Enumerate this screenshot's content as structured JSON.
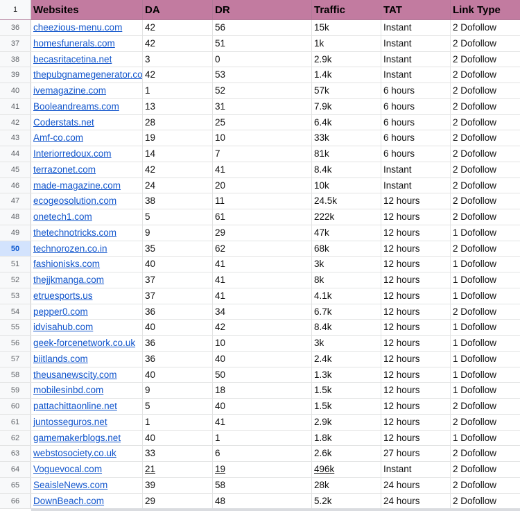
{
  "header": {
    "row_number": "1",
    "columns": [
      "Websites",
      "DA",
      "DR",
      "Traffic",
      "TAT",
      "Link Type"
    ]
  },
  "selected_row": "50",
  "rows": [
    {
      "n": "36",
      "site": "cheezious-menu.com",
      "da": "42",
      "dr": "56",
      "traffic": "15k",
      "tat": "Instant",
      "link": "2 Dofollow"
    },
    {
      "n": "37",
      "site": "homesfunerals.com",
      "da": "42",
      "dr": "51",
      "traffic": "1k",
      "tat": "Instant",
      "link": "2 Dofollow"
    },
    {
      "n": "38",
      "site": "becasritacetina.net",
      "da": "3",
      "dr": "0",
      "traffic": "2.9k",
      "tat": "Instant",
      "link": "2 Dofollow"
    },
    {
      "n": "39",
      "site": "thepubgnamegenerator.co",
      "da": "42",
      "dr": "53",
      "traffic": "1.4k",
      "tat": "Instant",
      "link": "2 Dofollow"
    },
    {
      "n": "40",
      "site": "ivemagazine.com",
      "da": "1",
      "dr": "52",
      "traffic": "57k",
      "tat": "6 hours",
      "link": "2 Dofollow"
    },
    {
      "n": "41",
      "site": "Booleandreams.com",
      "da": "13",
      "dr": "31",
      "traffic": "7.9k",
      "tat": "6 hours",
      "link": "2 Dofollow"
    },
    {
      "n": "42",
      "site": "Coderstats.net",
      "da": "28",
      "dr": "25",
      "traffic": "6.4k",
      "tat": "6 hours",
      "link": "2 Dofollow"
    },
    {
      "n": "43",
      "site": "Amf-co.com",
      "da": "19",
      "dr": "10",
      "traffic": "33k",
      "tat": "6 hours",
      "link": "2 Dofollow"
    },
    {
      "n": "44",
      "site": "Interiorredoux.com",
      "da": "14",
      "dr": "7",
      "traffic": "81k",
      "tat": "6 hours",
      "link": "2 Dofollow"
    },
    {
      "n": "45",
      "site": "terrazonet.com",
      "da": "42",
      "dr": "41",
      "traffic": "8.4k",
      "tat": "Instant",
      "link": "2 Dofollow"
    },
    {
      "n": "46",
      "site": "made-magazine.com",
      "da": "24",
      "dr": "20",
      "traffic": "10k",
      "tat": "Instant",
      "link": "2 Dofollow"
    },
    {
      "n": "47",
      "site": "ecogeosolution.com",
      "da": "38",
      "dr": "11",
      "traffic": "24.5k",
      "tat": "12 hours",
      "link": "2 Dofollow"
    },
    {
      "n": "48",
      "site": "onetech1.com",
      "da": "5",
      "dr": "61",
      "traffic": "222k",
      "tat": "12 hours",
      "link": "2 Dofollow"
    },
    {
      "n": "49",
      "site": "thetechnotricks.com",
      "da": "9",
      "dr": "29",
      "traffic": "47k",
      "tat": "12 hours",
      "link": "1 Dofollow"
    },
    {
      "n": "50",
      "site": "technorozen.co.in",
      "da": "35",
      "dr": "62",
      "traffic": "68k",
      "tat": "12 hours",
      "link": "2 Dofollow"
    },
    {
      "n": "51",
      "site": "fashionisks.com",
      "da": "40",
      "dr": "41",
      "traffic": "3k",
      "tat": "12 hours",
      "link": "1 Dofollow"
    },
    {
      "n": "52",
      "site": "thejjkmanga.com",
      "da": "37",
      "dr": "41",
      "traffic": "8k",
      "tat": "12 hours",
      "link": "1 Dofollow"
    },
    {
      "n": "53",
      "site": "etruesports.us",
      "da": "37",
      "dr": "41",
      "traffic": "4.1k",
      "tat": "12 hours",
      "link": "1 Dofollow"
    },
    {
      "n": "54",
      "site": "pepper0.com",
      "da": "36",
      "dr": "34",
      "traffic": "6.7k",
      "tat": "12 hours",
      "link": "2 Dofollow"
    },
    {
      "n": "55",
      "site": "idvisahub.com",
      "da": "40",
      "dr": "42",
      "traffic": "8.4k",
      "tat": "12 hours",
      "link": "1 Dofollow"
    },
    {
      "n": "56",
      "site": "geek-forcenetwork.co.uk",
      "da": "36",
      "dr": "10",
      "traffic": "3k",
      "tat": "12 hours",
      "link": "1 Dofollow"
    },
    {
      "n": "57",
      "site": "biitlands.com",
      "da": "36",
      "dr": "40",
      "traffic": "2.4k",
      "tat": "12 hours",
      "link": "1 Dofollow"
    },
    {
      "n": "58",
      "site": "theusanewscity.com",
      "da": "40",
      "dr": "50",
      "traffic": "1.3k",
      "tat": "12 hours",
      "link": "1 Dofollow"
    },
    {
      "n": "59",
      "site": "mobilesinbd.com",
      "da": "9",
      "dr": "18",
      "traffic": "1.5k",
      "tat": "12 hours",
      "link": "1 Dofollow"
    },
    {
      "n": "60",
      "site": "pattachittaonline.net",
      "da": "5",
      "dr": "40",
      "traffic": "1.5k",
      "tat": "12 hours",
      "link": "2 Dofollow"
    },
    {
      "n": "61",
      "site": "juntosseguros.net",
      "da": "1",
      "dr": "41",
      "traffic": "2.9k",
      "tat": "12 hours",
      "link": "2 Dofollow"
    },
    {
      "n": "62",
      "site": "gamemakerblogs.net",
      "da": "40",
      "dr": "1",
      "traffic": "1.8k",
      "tat": "12 hours",
      "link": "1 Dofollow"
    },
    {
      "n": "63",
      "site": "webstosociety.co.uk",
      "da": "33",
      "dr": "6",
      "traffic": "2.6k",
      "tat": "27 hours",
      "link": "2 Dofollow"
    },
    {
      "n": "64",
      "site": "Voguevocal.com",
      "da": "21",
      "dr": "19",
      "traffic": "496k",
      "tat": "Instant",
      "link": "2 Dofollow",
      "underline_values": true
    },
    {
      "n": "65",
      "site": "SeaisleNews.com",
      "da": "39",
      "dr": "58",
      "traffic": "28k",
      "tat": "24 hours",
      "link": "2 Dofollow"
    },
    {
      "n": "66",
      "site": "DownBeach.com",
      "da": "29",
      "dr": "48",
      "traffic": "5.2k",
      "tat": "24 hours",
      "link": "2 Dofollow"
    }
  ]
}
